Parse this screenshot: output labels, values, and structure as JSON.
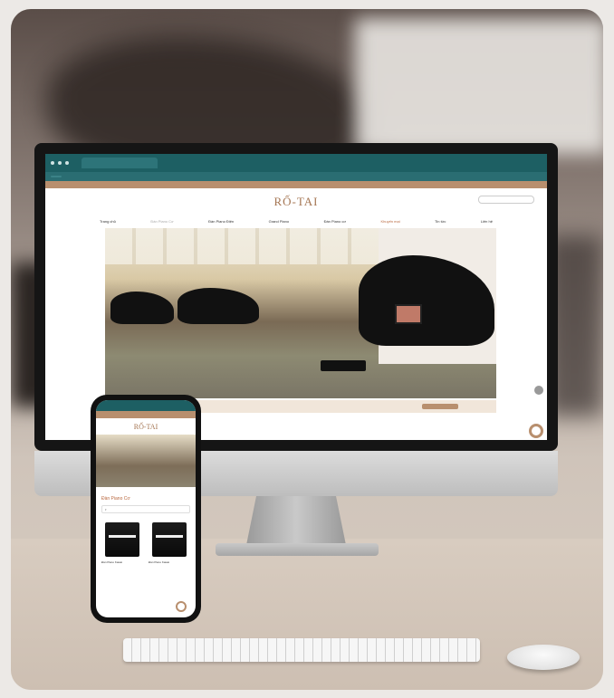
{
  "site": {
    "logo_text": "RỐ-TAI"
  },
  "nav": {
    "items": [
      "Trang chủ",
      "Đàn Piano Cơ",
      "Đàn Piano Điện",
      "Grand Piano",
      "Đàn Piano cơ",
      "Khuyến mại",
      "Tin tức",
      "Liên hệ"
    ]
  },
  "mobile": {
    "section_title": "Đàn Piano Cơ",
    "products": [
      {
        "name": "Đàn Piano Kawai",
        "price": ""
      },
      {
        "name": "Đàn Piano Kawai",
        "price": ""
      }
    ]
  },
  "colors": {
    "brand_teal": "#1d5f63",
    "brand_tan": "#b88f6e",
    "accent_orange": "#b9683f"
  }
}
